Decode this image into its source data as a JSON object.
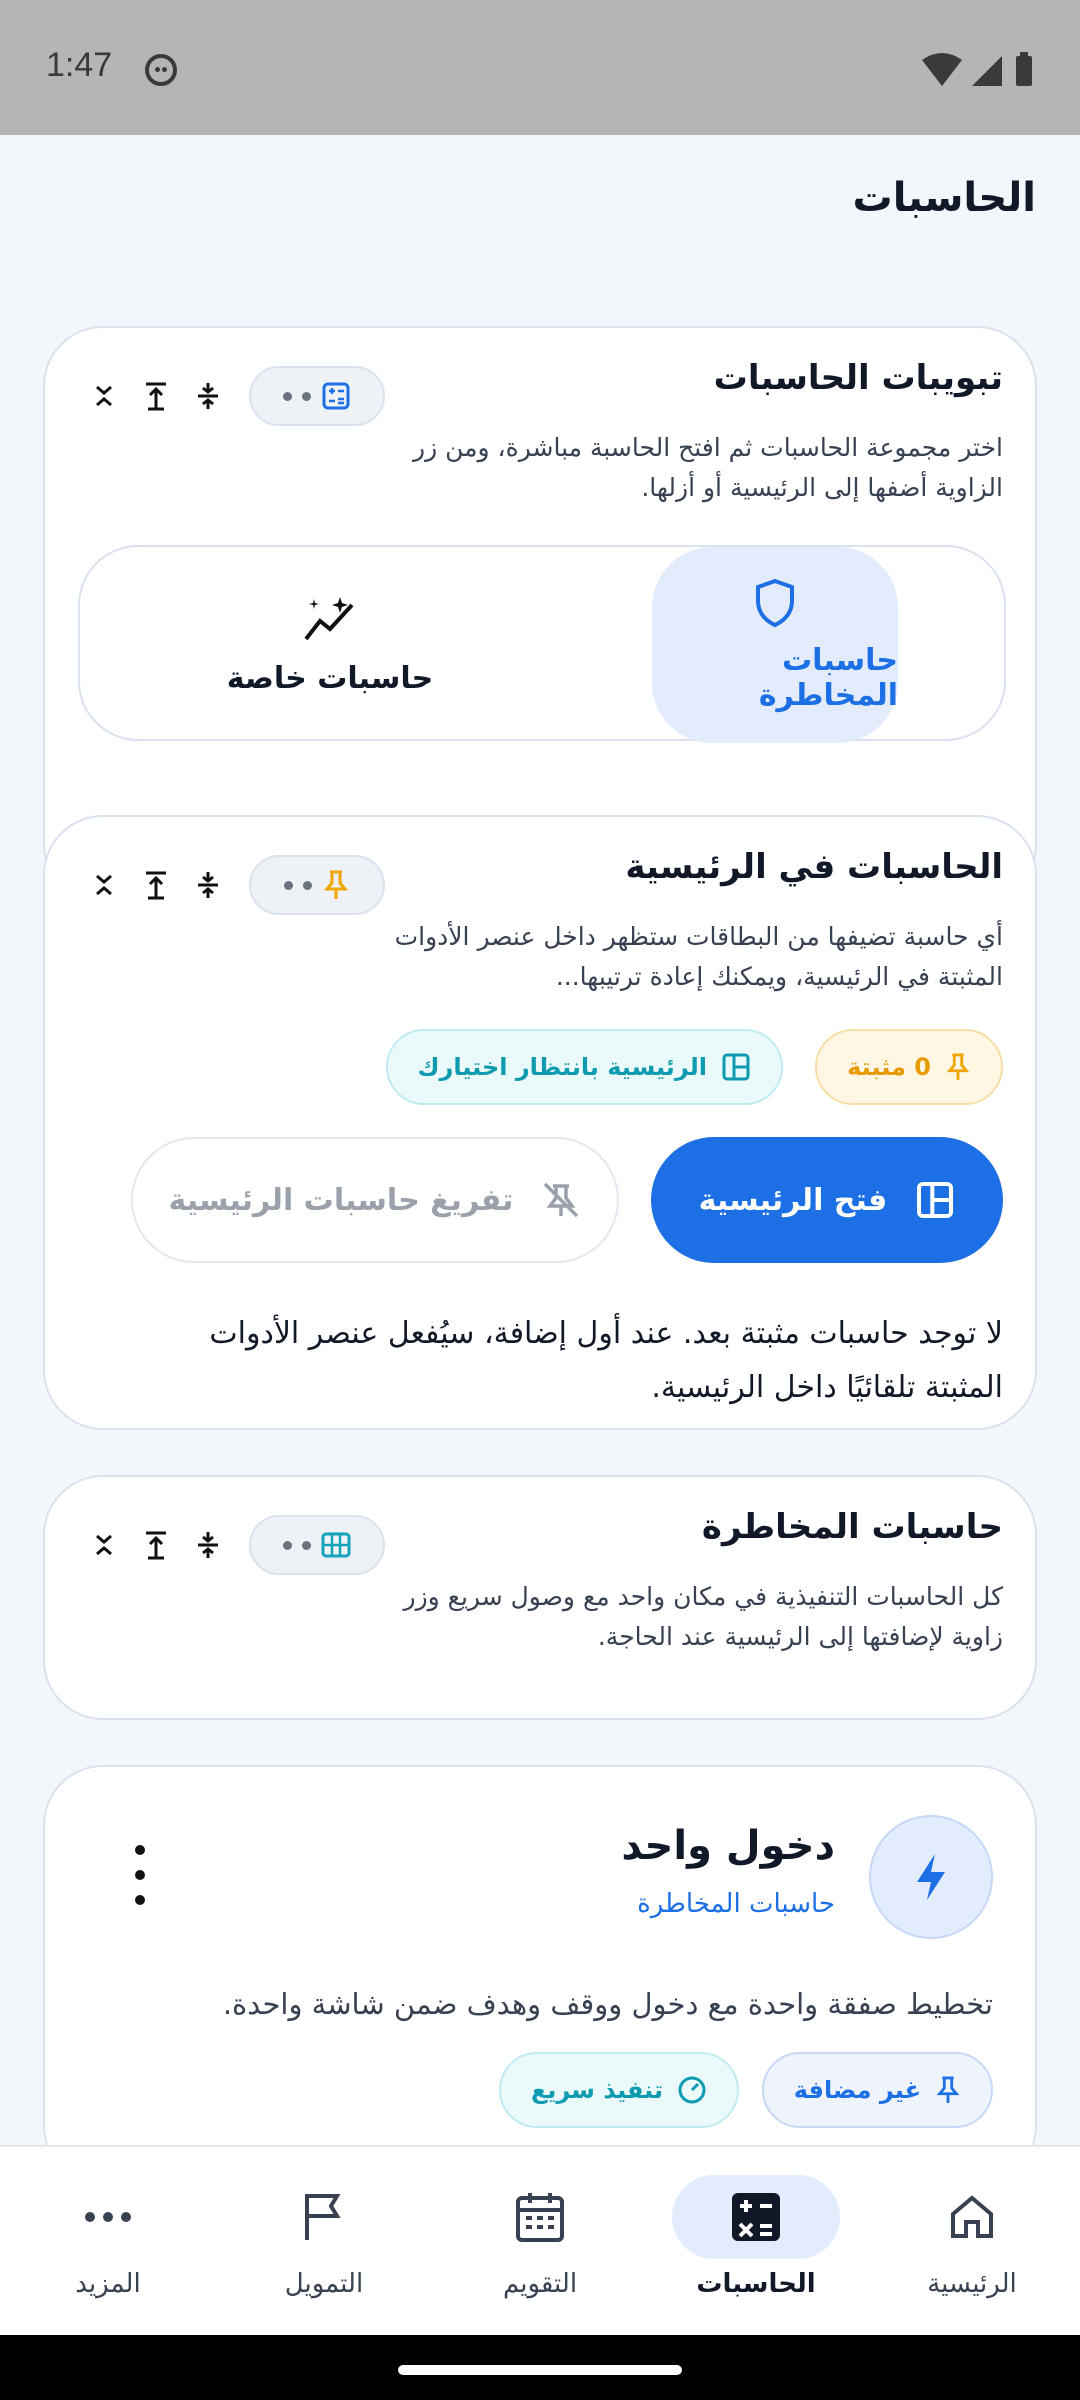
{
  "status_bar": {
    "time": "1:47"
  },
  "page": {
    "title": "الحاسبات"
  },
  "tabs_card": {
    "title": "تبويبات الحاسبات",
    "description": "اختر مجموعة الحاسبات ثم افتح الحاسبة مباشرة، ومن زر الزاوية أضفها إلى الرئيسية أو أزلها.",
    "segments": [
      {
        "label": "حاسبات المخاطرة",
        "icon": "shield-icon",
        "active": true
      },
      {
        "label": "حاسبات خاصة",
        "icon": "sparkle-icon",
        "active": false
      }
    ]
  },
  "home_card": {
    "title": "الحاسبات في الرئيسية",
    "description": "أي حاسبة تضيفها من البطاقات ستظهر داخل عنصر الأدوات المثبتة في الرئيسية، ويمكنك إعادة ترتيبها...",
    "pinned_chip": "0 مثبتة",
    "home_chip": "الرئيسية بانتظار اختيارك",
    "open_home_button": "فتح الرئيسية",
    "clear_button": "تفريغ حاسبات الرئيسية",
    "empty_note": "لا توجد حاسبات مثبتة بعد. عند أول إضافة، سيُفعل عنصر الأدوات المثبتة تلقائيًا داخل الرئيسية."
  },
  "risk_card": {
    "title": "حاسبات المخاطرة",
    "description": "كل الحاسبات التنفيذية في مكان واحد مع وصول سريع وزر زاوية لإضافتها إلى الرئيسية عند الحاجة."
  },
  "single_entry_card": {
    "title": "دخول واحد",
    "subtitle": "حاسبات المخاطرة",
    "description": "تخطيط صفقة واحدة مع دخول ووقف وهدف ضمن شاشة واحدة.",
    "chip_not_added": "غير مضافة",
    "chip_quick": "تنفيذ سريع"
  },
  "bottom_nav": [
    {
      "label": "الرئيسية",
      "icon": "home-icon",
      "active": false
    },
    {
      "label": "الحاسبات",
      "icon": "calculator-icon",
      "active": true
    },
    {
      "label": "التقويم",
      "icon": "calendar-icon",
      "active": false
    },
    {
      "label": "التمويل",
      "icon": "flag-icon",
      "active": false
    },
    {
      "label": "المزيد",
      "icon": "more-icon",
      "active": false
    }
  ],
  "colors": {
    "accent": "#1d6fe5",
    "accent_soft": "#e3ecfc",
    "pin_amber": "#f0a500",
    "teal": "#14a3b8"
  }
}
